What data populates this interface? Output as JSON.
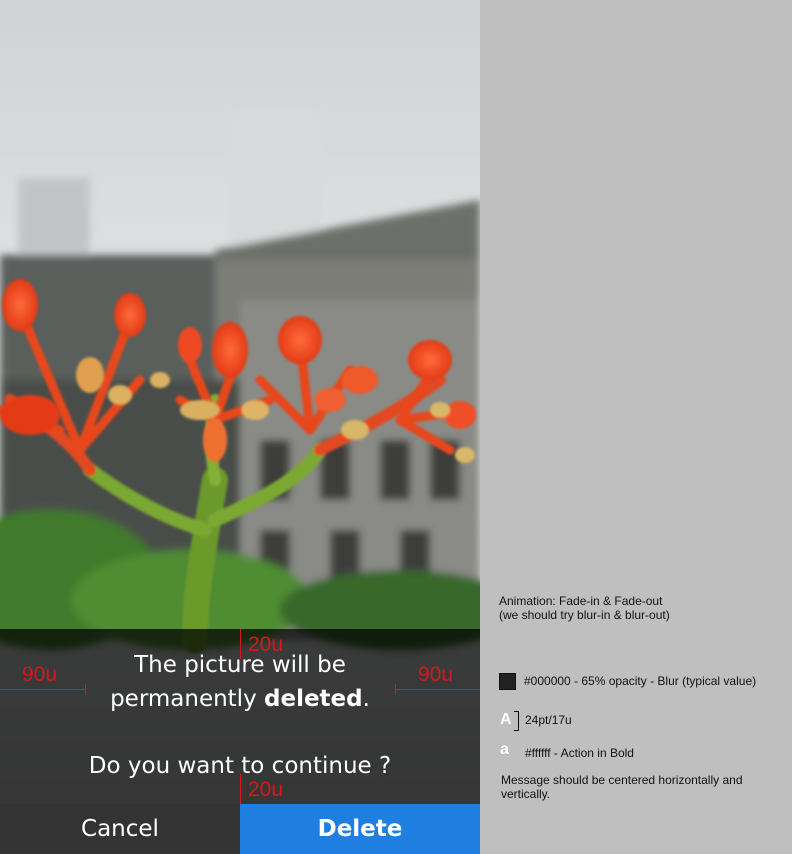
{
  "dialog": {
    "message_line1": "The picture will be",
    "message_line2_prefix": "permanently ",
    "message_line2_bold": "deleted",
    "message_line2_suffix": ".",
    "question": "Do you want to continue ?",
    "cancel_label": "Cancel",
    "delete_label": "Delete"
  },
  "dimensions": {
    "top": "20u",
    "bottom": "20u",
    "left": "90u",
    "right": "90u"
  },
  "spec": {
    "animation_line1": "Animation: Fade-in & Fade-out",
    "animation_line2": "(we should try blur-in & blur-out)",
    "background": "#000000 - 65% opacity - Blur (typical value)",
    "font_icon_glyph": "A",
    "font_size": "24pt/17u",
    "color_icon_glyph": "a",
    "text_color": "#ffffff - Action in Bold",
    "centering_note_line1": "Message should be centered horizontally and",
    "centering_note_line2": "vertically."
  },
  "colors": {
    "cancel_bg": "#333333",
    "delete_bg": "#1f7fe0",
    "dimension": "#d21a1a",
    "panel_bg": "#bfbfbf"
  },
  "icons": {
    "swatch": "color-swatch-icon",
    "font": "font-size-icon",
    "color": "text-color-icon"
  }
}
